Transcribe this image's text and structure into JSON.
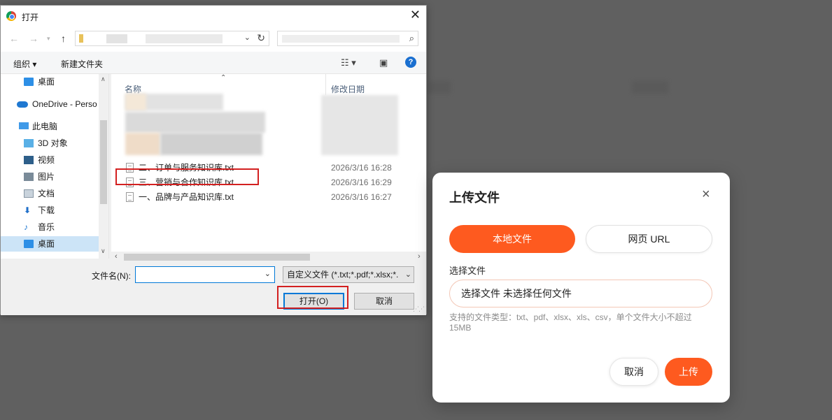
{
  "dialog": {
    "title": "打开",
    "toolbar": {
      "organize": "组织 ▾",
      "new_folder": "新建文件夹",
      "help": "?"
    },
    "nav": [
      {
        "label": "桌面",
        "icon": "desktop-icon"
      },
      {
        "label": "OneDrive - Perso",
        "icon": "onedrive-icon"
      },
      {
        "label": "此电脑",
        "icon": "computer-icon"
      },
      {
        "label": "3D 对象",
        "icon": "3d-objects-icon"
      },
      {
        "label": "视频",
        "icon": "video-icon"
      },
      {
        "label": "图片",
        "icon": "pictures-icon"
      },
      {
        "label": "文档",
        "icon": "documents-icon"
      },
      {
        "label": "下载",
        "icon": "downloads-icon"
      },
      {
        "label": "音乐",
        "icon": "music-icon"
      },
      {
        "label": "桌面",
        "icon": "desktop-icon",
        "selected": true
      }
    ],
    "columns": {
      "name": "名称",
      "date": "修改日期"
    },
    "files": [
      {
        "name": "二、订单与服务知识库.txt",
        "date": "2026/3/16 16:28"
      },
      {
        "name": "三、营销与合作知识库.txt",
        "date": "2026/3/16 16:29",
        "highlighted": true
      },
      {
        "name": "一、品牌与产品知识库.txt",
        "date": "2026/3/16 16:27"
      }
    ],
    "filename_label": "文件名(N):",
    "filename_value": "",
    "filter": "自定义文件 (*.txt;*.pdf;*.xlsx;*.",
    "open_label": "打开(O)",
    "cancel_label": "取消"
  },
  "upload_modal": {
    "title": "上传文件",
    "tabs": {
      "local": "本地文件",
      "url": "网页 URL"
    },
    "select_label": "选择文件",
    "file_input_text": "选择文件 未选择任何文件",
    "hint": "支持的文件类型：txt、pdf、xlsx、xls、csv，单个文件大小不超过15MB",
    "cancel": "取消",
    "upload": "上传",
    "accent_color": "#fe5a1f"
  },
  "highlight_color": "#d32020"
}
